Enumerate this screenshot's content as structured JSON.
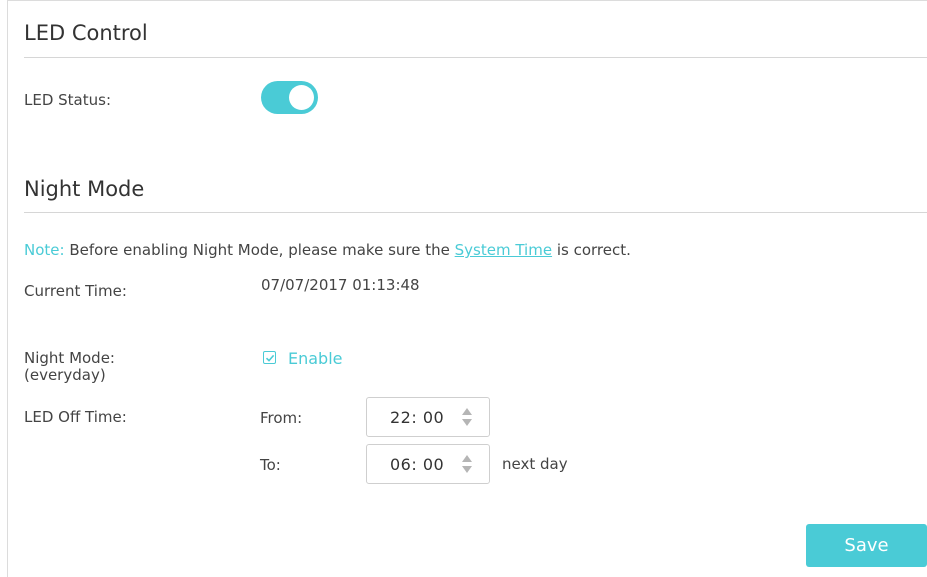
{
  "led_control": {
    "title": "LED Control",
    "status_label": "LED Status:",
    "status_on": true
  },
  "night_mode": {
    "title": "Night Mode",
    "note_label": "Note:",
    "note_text_before": "Before enabling Night Mode, please make sure the",
    "note_link": "System Time",
    "note_text_after": "is correct.",
    "current_time_label": "Current Time:",
    "current_time_value": "07/07/2017 01:13:48",
    "mode_label_line1": "Night Mode:",
    "mode_label_line2": "(everyday)",
    "enable_label": "Enable",
    "enable_checked": true,
    "off_time_label": "LED Off Time:",
    "from_label": "From:",
    "from_value": "22: 00",
    "to_label": "To:",
    "to_value": "06: 00",
    "next_day_text": "next day"
  },
  "actions": {
    "save_label": "Save"
  },
  "colors": {
    "accent": "#4acbd6",
    "text": "#444444",
    "divider": "#d6d6d6"
  }
}
